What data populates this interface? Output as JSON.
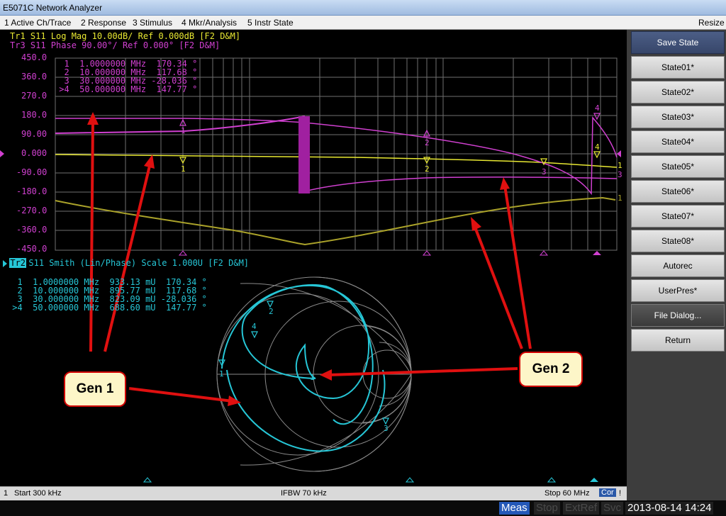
{
  "window": {
    "title": "E5071C Network Analyzer"
  },
  "menu": {
    "items": [
      "1 Active Ch/Trace",
      "2 Response",
      "3 Stimulus",
      "4 Mkr/Analysis",
      "5 Instr State"
    ],
    "resize": "Resize"
  },
  "upper": {
    "tr1_header": "Tr1 S11 Log Mag 10.00dB/ Ref 0.000dB [F2 D&M]",
    "tr3_header": "Tr3 S11 Phase 90.00°/ Ref 0.000° [F2 D&M]",
    "y_ticks": [
      "450.0",
      "360.0",
      "270.0",
      "180.0",
      "90.00",
      "0.000",
      "-90.00",
      "-180.0",
      "-270.0",
      "-360.0",
      "-450.0"
    ],
    "markers": [
      "  1  1.0000000 MHz  170.34 °",
      "  2  10.000000 MHz  117.68 °",
      "  3  30.000000 MHz -28.036 °",
      " >4  50.000000 MHz  147.77 °"
    ]
  },
  "lower": {
    "tr2_tag": "Tr2",
    "tr2_header": "S11 Smith (Lin/Phase) Scale 1.000U [F2 D&M]",
    "markers": [
      "  1  1.0000000 MHz  933.13 mU  170.34 °",
      "  2  10.000000 MHz  895.77 mU  117.68 °",
      "  3  30.000000 MHz  823.09 mU -28.036 °",
      " >4  50.000000 MHz  688.60 mU  147.77 °"
    ]
  },
  "softkeys": {
    "header": "Save State",
    "items": [
      "State01*",
      "State02*",
      "State03*",
      "State04*",
      "State05*",
      "State06*",
      "State07*",
      "State08*",
      "Autorec",
      "UserPres*",
      "File Dialog...",
      "Return"
    ]
  },
  "status": {
    "channel": "1",
    "start": "Start 300 kHz",
    "ifbw": "IFBW 70 kHz",
    "stop": "Stop 60 MHz",
    "cor": "Cor",
    "bang": "!"
  },
  "bottom": {
    "meas": "Meas",
    "stop": "Stop",
    "extref": "ExtRef",
    "svc": "Svc",
    "datetime": "2013-08-14 14:24"
  },
  "callouts": {
    "gen1": "Gen 1",
    "gen2": "Gen 2"
  },
  "colors": {
    "trace_mag": "#e8e832",
    "trace_phase": "#d040d0",
    "trace_dark": "#aaa22a",
    "smith": "#26c6d6",
    "arrow": "#e01010"
  }
}
